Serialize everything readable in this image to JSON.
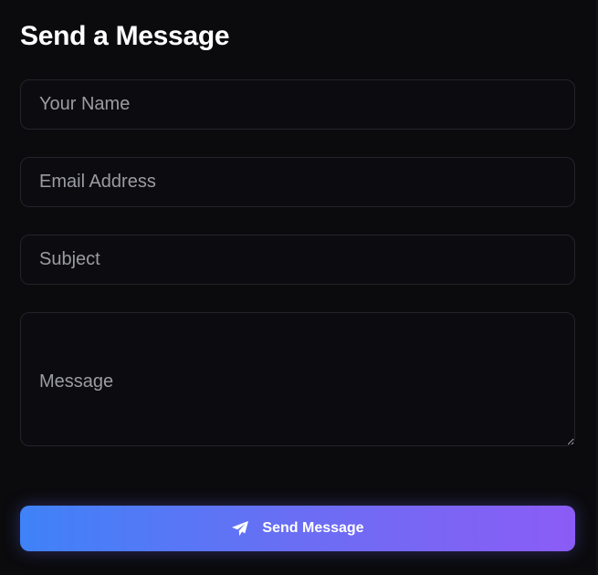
{
  "form": {
    "title": "Send a Message",
    "name_placeholder": "Your Name",
    "email_placeholder": "Email Address",
    "subject_placeholder": "Subject",
    "message_placeholder": "Message",
    "submit_label": "Send Message",
    "submit_icon": "paper-plane-icon"
  },
  "colors": {
    "background": "#0b0b0e",
    "field_border": "#23232a",
    "button_gradient_start": "#3f82f8",
    "button_gradient_end": "#8b5cf6",
    "text_primary": "#ffffff",
    "placeholder": "#9b9ba3"
  }
}
